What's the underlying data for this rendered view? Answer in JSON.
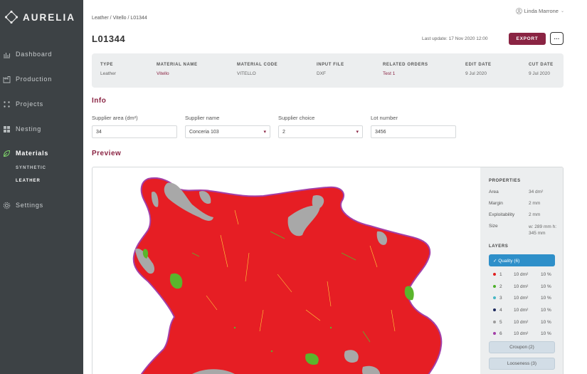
{
  "app": {
    "brand": "AURELIA"
  },
  "sidebar": {
    "items": [
      {
        "label": "Dashboard",
        "icon": "bar-chart-icon"
      },
      {
        "label": "Production",
        "icon": "factory-icon"
      },
      {
        "label": "Projects",
        "icon": "grid-dots-icon"
      },
      {
        "label": "Nesting",
        "icon": "tiles-icon"
      },
      {
        "label": "Materials",
        "icon": "materials-icon"
      },
      {
        "label": "Settings",
        "icon": "gear-icon"
      }
    ],
    "sub_items": [
      "SYNTHETIC",
      "LEATHER"
    ]
  },
  "header": {
    "breadcrumb": "Leather / Vitello / L01344",
    "user": "Linda Marrone",
    "title": "L01344",
    "last_update": "Last update: 17 Nov 2020 12:00",
    "export_label": "EXPORT",
    "more_label": "···"
  },
  "meta": [
    {
      "label": "TYPE",
      "value": "Leather"
    },
    {
      "label": "MATERIAL NAME",
      "value": "Vitello"
    },
    {
      "label": "MATERIAL CODE",
      "value": "VITELLO"
    },
    {
      "label": "INPUT FILE",
      "value": "DXF"
    },
    {
      "label": "RELATED ORDERS",
      "value": "Test 1"
    },
    {
      "label": "EDIT DATE",
      "value": "9 Jul 2020"
    },
    {
      "label": "CUT DATE",
      "value": "9 Jul 2020"
    }
  ],
  "info": {
    "title": "Info",
    "fields": [
      {
        "label": "Supplier area (dm²)",
        "value": "34"
      },
      {
        "label": "Supplier name",
        "value": "Conceria 103"
      },
      {
        "label": "Supplier choice",
        "value": "2"
      },
      {
        "label": "Lot number",
        "value": "3456"
      }
    ]
  },
  "preview": {
    "title": "Preview",
    "properties_title": "PROPERTIES",
    "properties": [
      {
        "label": "Area",
        "value": "34 dm²"
      },
      {
        "label": "Margin",
        "value": "2 mm"
      },
      {
        "label": "Exploitability",
        "value": "2 mm"
      },
      {
        "label": "Size",
        "value": "w: 289 mm h: 345 mm"
      }
    ],
    "layers_title": "LAYERS",
    "quality_label": "✓ Quality (6)",
    "layers": [
      {
        "id": "1",
        "area": "10 dm²",
        "pct": "10 %",
        "color": "#e02020"
      },
      {
        "id": "2",
        "area": "10 dm²",
        "pct": "10 %",
        "color": "#4caf28"
      },
      {
        "id": "3",
        "area": "10 dm²",
        "pct": "10 %",
        "color": "#47b7c4"
      },
      {
        "id": "4",
        "area": "10 dm²",
        "pct": "10 %",
        "color": "#1d2a5e"
      },
      {
        "id": "5",
        "area": "10 dm²",
        "pct": "10 %",
        "color": "#9b9b9b"
      },
      {
        "id": "6",
        "area": "10 dm²",
        "pct": "10 %",
        "color": "#a33fa8"
      }
    ],
    "croupon_label": "Croupon (2)",
    "looseness_label": "Looseness (3)"
  },
  "colors": {
    "accent": "#8a2443",
    "sidebar": "#3d4245",
    "primary_button": "#2e8fc9"
  }
}
